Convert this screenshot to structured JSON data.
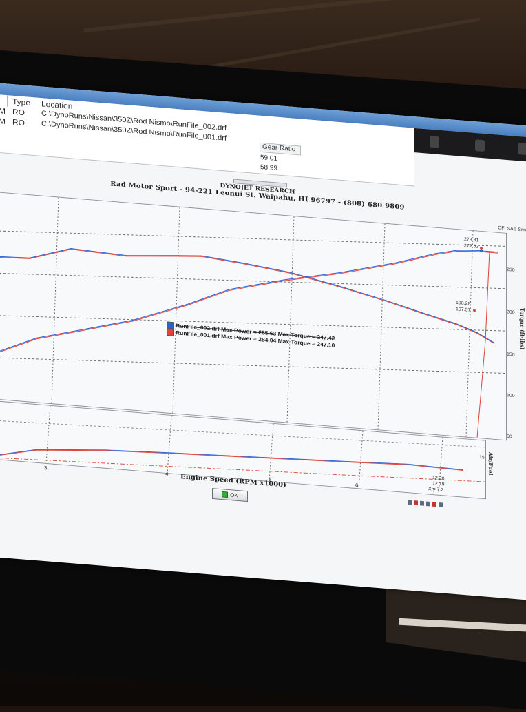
{
  "run_list": {
    "headers": {
      "type": "Type",
      "location": "Location",
      "gear_ratio": "Gear Ratio"
    },
    "rows": [
      {
        "prefix": "PM",
        "type": "RO",
        "location": "C:\\DynoRuns\\Nissan\\350Z\\Rod Nismo\\RunFile_002.drf",
        "gear_ratio": "59.01"
      },
      {
        "prefix": "PM",
        "type": "RO",
        "location": "C:\\DynoRuns\\Nissan\\350Z\\Rod Nismo\\RunFile_001.drf",
        "gear_ratio": "58.99"
      }
    ]
  },
  "header": {
    "title": "DYNOJET RESEARCH",
    "subtitle": "Rad Motor Sport - 94-221 Leonui St. Waipahu, HI 96797 - (808) 680 9809",
    "cf_label": "CF: SAE  Smoothi"
  },
  "legend": [
    {
      "text": "RunFile_002.drf Max Power = 285.63 Max Torque = 247.42",
      "color": "#2a5fd6"
    },
    {
      "text": "RunFile_001.drf Max Power = 284.04 Max Torque = 247.10",
      "color": "#e0433a"
    }
  ],
  "value_labels": {
    "power_top": "273.31",
    "power_bottom": "272.53",
    "torque_top": "198.28",
    "torque_bottom": "197.57",
    "af_top": "12.20",
    "af_bottom": "12.19",
    "af_x": "X = 7.2"
  },
  "axis": {
    "right_ticks": [
      "250",
      "200",
      "150",
      "100",
      "50"
    ],
    "right_title": "Torque (ft-lbs)",
    "lower_tick": "15",
    "lower_title": "Air/Fuel",
    "x_ticks": [
      "3",
      "4",
      "5",
      "6",
      "7"
    ],
    "x_title": "Engine Speed (RPM x1000)"
  },
  "ok_label": "OK",
  "colors": {
    "run_002": "#2a5fd6",
    "run_001": "#e0433a"
  },
  "chart_data": {
    "type": "line",
    "xlabel": "Engine Speed (RPM x1000)",
    "ylabel": "Torque (ft-lbs)",
    "series": [
      {
        "name": "RunFile_002.drf",
        "max_power": 285.63,
        "max_torque": 247.42
      },
      {
        "name": "RunFile_001.drf",
        "max_power": 284.04,
        "max_torque": 247.1
      }
    ],
    "grid": true
  }
}
